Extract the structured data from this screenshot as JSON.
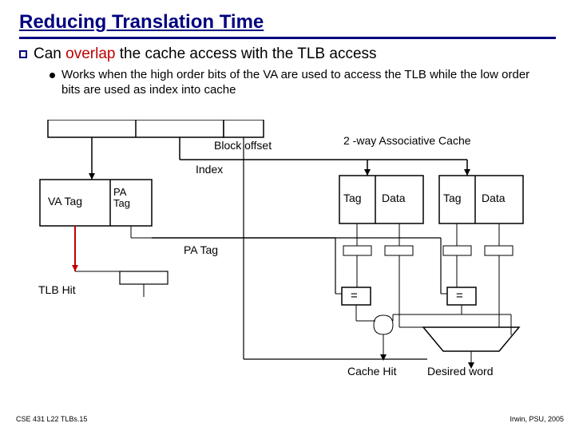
{
  "title": "Reducing Translation Time",
  "bullet": {
    "pre": "Can ",
    "overlap": "overlap",
    "post": " the cache access with the TLB access"
  },
  "sub": "Works when the high order bits of the VA are used to access the TLB while the low order bits are used as index into cache",
  "labels": {
    "block_offset": "Block offset",
    "index": "Index",
    "va_tag": "VA Tag",
    "pa_tag_small": "PA Tag",
    "pa_tag": "PA Tag",
    "tlb_hit": "TLB Hit",
    "assoc": "2 -way Associative Cache",
    "tag1": "Tag",
    "data1": "Data",
    "tag2": "Tag",
    "data2": "Data",
    "eq1": "=",
    "eq2": "=",
    "cache_hit": "Cache Hit",
    "desired": "Desired word"
  },
  "footer": {
    "left": "CSE 431  L22 TLBs.15",
    "right": "Irwin, PSU, 2005"
  }
}
